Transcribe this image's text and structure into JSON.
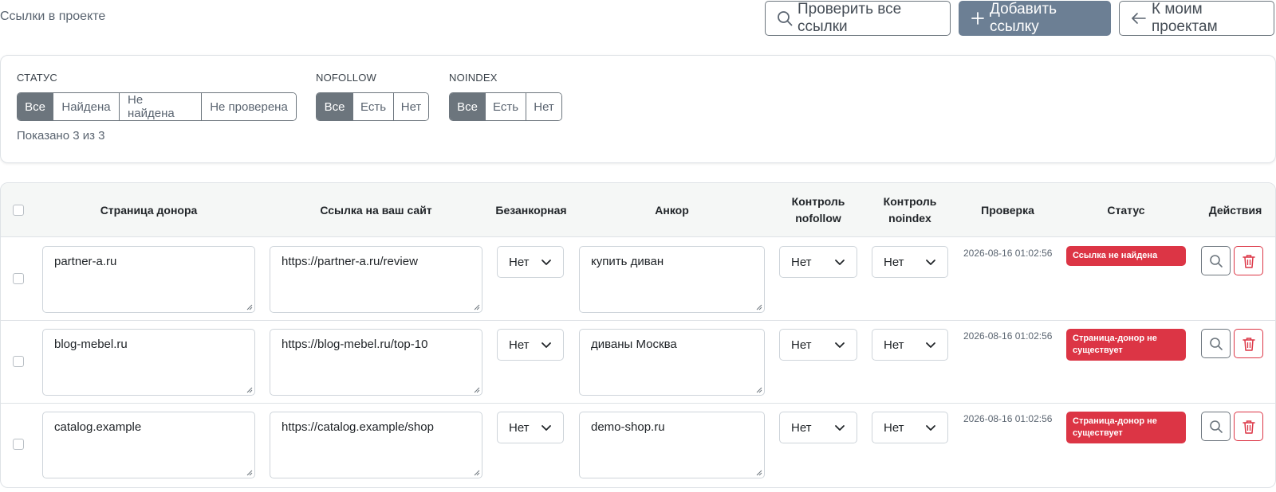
{
  "header": {
    "title": "Ссылки в проекте",
    "check_all_label": "Проверить все ссылки",
    "add_link_label": "Добавить ссылку",
    "back_label": "К моим проектам"
  },
  "filters": {
    "status": {
      "label": "СТАТУС",
      "options": [
        "Все",
        "Найдена",
        "Не найдена",
        "Не проверена"
      ],
      "active": 0
    },
    "nofollow": {
      "label": "NOFOLLOW",
      "options": [
        "Все",
        "Есть",
        "Нет"
      ],
      "active": 0
    },
    "noindex": {
      "label": "NOINDEX",
      "options": [
        "Все",
        "Есть",
        "Нет"
      ],
      "active": 0
    },
    "shown_text": "Показано 3 из 3"
  },
  "table": {
    "columns": {
      "donor": "Страница донора",
      "link": "Ссылка на ваш сайт",
      "anchorless": "Безанкорная",
      "anchor": "Анкор",
      "nofollow_line1": "Контроль",
      "nofollow_line2": "nofollow",
      "noindex_line1": "Контроль",
      "noindex_line2": "noindex",
      "check": "Проверка",
      "status": "Статус",
      "actions": "Действия"
    },
    "rows": [
      {
        "donor": "partner-a.ru",
        "link": "https://partner-a.ru/review",
        "anchorless": "Нет",
        "anchor": "купить диван",
        "nofollow": "Нет",
        "noindex": "Нет",
        "checked_at": "2026-08-16 01:02:56",
        "status": "Ссылка не найдена"
      },
      {
        "donor": "blog-mebel.ru",
        "link": "https://blog-mebel.ru/top-10",
        "anchorless": "Нет",
        "anchor": "диваны Москва",
        "nofollow": "Нет",
        "noindex": "Нет",
        "checked_at": "2026-08-16 01:02:56",
        "status": "Страница-донор не существует"
      },
      {
        "donor": "catalog.example",
        "link": "https://catalog.example/shop",
        "anchorless": "Нет",
        "anchor": "demo-shop.ru",
        "nofollow": "Нет",
        "noindex": "Нет",
        "checked_at": "2026-08-16 01:02:56",
        "status": "Страница-донор не существует"
      }
    ]
  },
  "colors": {
    "primary": "#6c7f94",
    "secondary": "#6c757d",
    "danger": "#dc3545",
    "header_bg": "#f5f7f6"
  },
  "icons": {
    "check_all": "search-icon",
    "add": "plus-icon",
    "back": "arrow-left-icon",
    "view": "search-icon",
    "delete": "trash-icon",
    "select": "chevron-down-icon"
  }
}
